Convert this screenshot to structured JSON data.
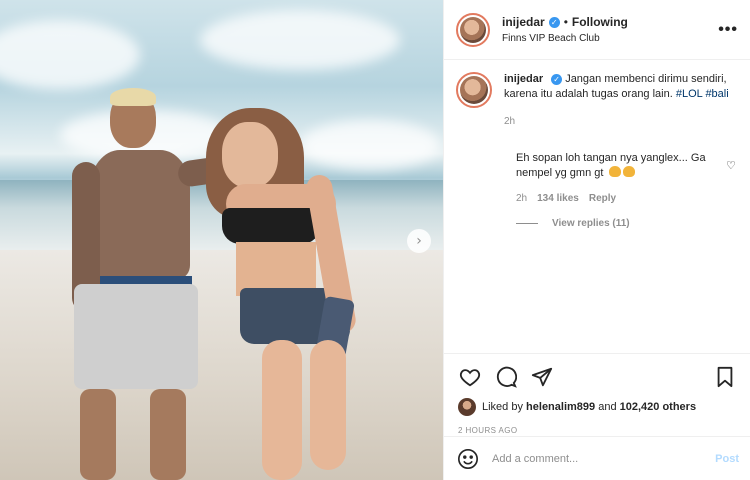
{
  "header": {
    "username": "inijedar",
    "separator": "•",
    "follow_label": "Following",
    "location": "Finns VIP Beach Club",
    "more_icon": "more-dots-icon"
  },
  "caption": {
    "username": "inijedar",
    "text": "Jangan membenci dirimu sendiri, karena itu adalah tugas orang lain.",
    "tags": [
      "#LOL",
      "#bali"
    ],
    "time": "2h"
  },
  "reply": {
    "text": "Eh sopan loh tangan nya yanglex... Ga nempel yg gmn gt",
    "emoji": "clapping-hands-emoji",
    "time": "2h",
    "likes": "134 likes",
    "reply_label": "Reply",
    "view_replies": "View replies (11)"
  },
  "likes_row": {
    "prefix": "Liked by",
    "user": "helenalim899",
    "and": "and",
    "count": "102,420 others"
  },
  "time_ago": "2 HOURS AGO",
  "add_comment": {
    "placeholder": "Add a comment...",
    "post_label": "Post"
  },
  "icons": {
    "like": "heart-icon",
    "comment": "comment-icon",
    "share": "paper-plane-icon",
    "save": "bookmark-icon",
    "emoji": "smiley-icon",
    "next": "chevron-right-icon"
  },
  "colors": {
    "verified": "#3897f0",
    "link": "#00376b",
    "muted": "#8e8e8e",
    "post_disabled": "#b3dbff"
  }
}
